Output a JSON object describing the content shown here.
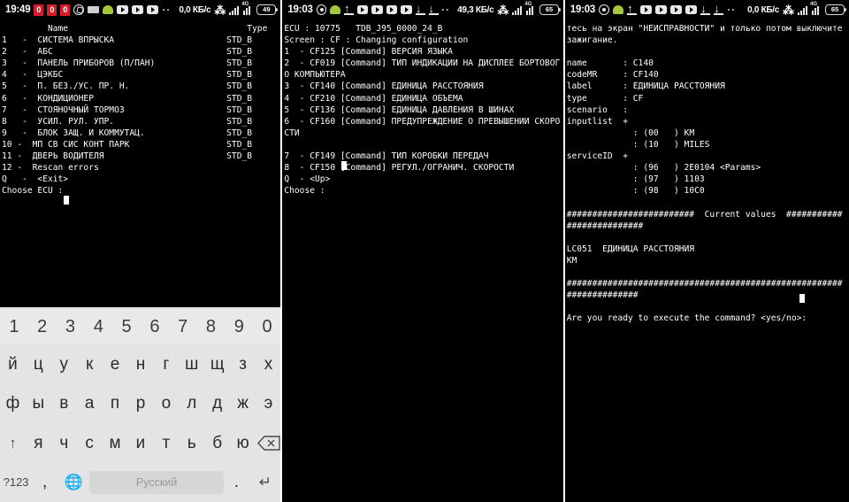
{
  "panels": [
    {
      "id": "panel-ecu-list",
      "statusbar": {
        "clock": "19:49",
        "data_rate": "0,0 КБ/с",
        "battery": "49",
        "icons": [
          "badge-0-red",
          "badge-0-red",
          "badge-0-red",
          "viber-icon",
          "sms-icon",
          "android-icon",
          "youtube-icon",
          "youtube-icon",
          "youtube-icon",
          "ellipsis-icon",
          "bluetooth-icon",
          "signal-icon",
          "signal-4g-icon",
          "battery-icon"
        ]
      },
      "terminal": "         Name                                   Type\n1   -  СИСТЕМА ВПРЫСКА                      STD_B\n2   -  АБС                                  STD_B\n3   -  ПАНЕЛЬ ПРИБОРОВ (П/ПАН)              STD_B\n4   -  ЦЭКБС                                STD_B\n5   -  П. БЕЗ./УС. ПР. Н.                   STD_B\n6   -  КОНДИЦИОНЕР                          STD_B\n7   -  СТОЯНОЧНЫЙ ТОРМОЗ                    STD_B\n8   -  УСИЛ. РУЛ. УПР.                      STD_B\n9   -  БЛОК ЗАЩ. И КОММУТАЦ.                STD_B\n10 -  МП СВ СИС КОНТ ПАРК                   STD_B\n11 -  ДВЕРЬ ВОДИТЕЛЯ                        STD_B\n12 -  Rescan errors\nQ   -  <Exit>\nChoose ECU :",
      "keyboard": {
        "rows": [
          {
            "type": "num",
            "keys": [
              "1",
              "2",
              "3",
              "4",
              "5",
              "6",
              "7",
              "8",
              "9",
              "0"
            ]
          },
          {
            "type": "letters",
            "keys": [
              "й",
              "ц",
              "у",
              "к",
              "е",
              "н",
              "г",
              "ш",
              "щ",
              "з",
              "х"
            ]
          },
          {
            "type": "letters",
            "keys": [
              "ф",
              "ы",
              "в",
              "а",
              "п",
              "р",
              "о",
              "л",
              "д",
              "ж",
              "э"
            ]
          },
          {
            "type": "letters",
            "keys": [
              "↑",
              "я",
              "ч",
              "с",
              "м",
              "и",
              "т",
              "ь",
              "б",
              "ю",
              "⌫"
            ]
          },
          {
            "type": "bottom",
            "keys": [
              "?123",
              ",",
              "🌐",
              "Русский",
              ".",
              "↵"
            ]
          }
        ],
        "space_label": "Русский",
        "symbols_label": "?123",
        "comma_label": ",",
        "period_label": ".",
        "globe_name": "globe-icon",
        "shift_name": "shift-icon",
        "backspace_name": "backspace-icon",
        "enter_name": "enter-icon"
      }
    },
    {
      "id": "panel-cf-config",
      "statusbar": {
        "clock": "19:03",
        "data_rate": "49,3 КБ/с",
        "battery": "65",
        "icons": [
          "circle-pin-icon",
          "android-icon",
          "upload-icon",
          "youtube-icon",
          "youtube-icon",
          "youtube-icon",
          "youtube-icon",
          "download-icon",
          "download-icon",
          "ellipsis-icon",
          "bluetooth-icon",
          "signal-icon",
          "signal-4g-icon",
          "battery-icon"
        ]
      },
      "terminal": "ECU : 10775   TDB_J95_0000_24_B\nScreen : CF : Changing configuration\n1  - CF125 [Command] ВЕРСИЯ ЯЗЫКА\n2  - CF019 [Command] ТИП ИНДИКАЦИИ НА ДИСПЛЕЕ БОРТОВОГО КОМПЬЮТЕРА\n3  - CF140 [Command] ЕДИНИЦА РАССТОЯНИЯ\n4  - CF210 [Command] ЕДИНИЦА ОБЪЕМА\n5  - CF136 [Command] ЕДИНИЦА ДАВЛЕНИЯ В ШИНАХ\n6  - CF160 [Command] ПРЕДУПРЕЖДЕНИЕ О ПРЕВЫШЕНИИ СКОРОСТИ\n\n7  - CF149 [Command] ТИП КОРОБКИ ПЕРЕДАЧ\n8  - CF150 [Command] РЕГУЛ./ОГРАНИЧ. СКОРОСТИ\nQ  - <Up>\nChoose :"
    },
    {
      "id": "panel-command-confirm",
      "statusbar": {
        "clock": "19:03",
        "data_rate": "0,0 КБ/с",
        "battery": "65",
        "icons": [
          "circle-pin-icon",
          "android-icon",
          "upload-icon",
          "youtube-icon",
          "youtube-icon",
          "youtube-icon",
          "youtube-icon",
          "download-icon",
          "download-icon",
          "ellipsis-icon",
          "bluetooth-icon",
          "signal-icon",
          "signal-4g-icon",
          "battery-icon"
        ]
      },
      "terminal": "тесь на экран \"НЕИСПРАВНОСТИ\" и только потом выключите зажигание.\n\nname       : C140\ncodeMR     : CF140\nlabel      : ЕДИНИЦА РАССТОЯНИЯ\ntype       : CF\nscenario   :\ninputlist  +\n             : (00   ) КМ\n             : (10   ) MILES\nserviceID  +\n             : (96   ) 2E0104 <Params>\n             : (97   ) 1103\n             : (98   ) 10C0\n\n#########################  Current values  ##########################\n\nLC051  ЕДИНИЦА РАССТОЯНИЯ\nКМ\n\n####################################################################\n\nAre you ready to execute the command? <yes/no>:"
    }
  ]
}
